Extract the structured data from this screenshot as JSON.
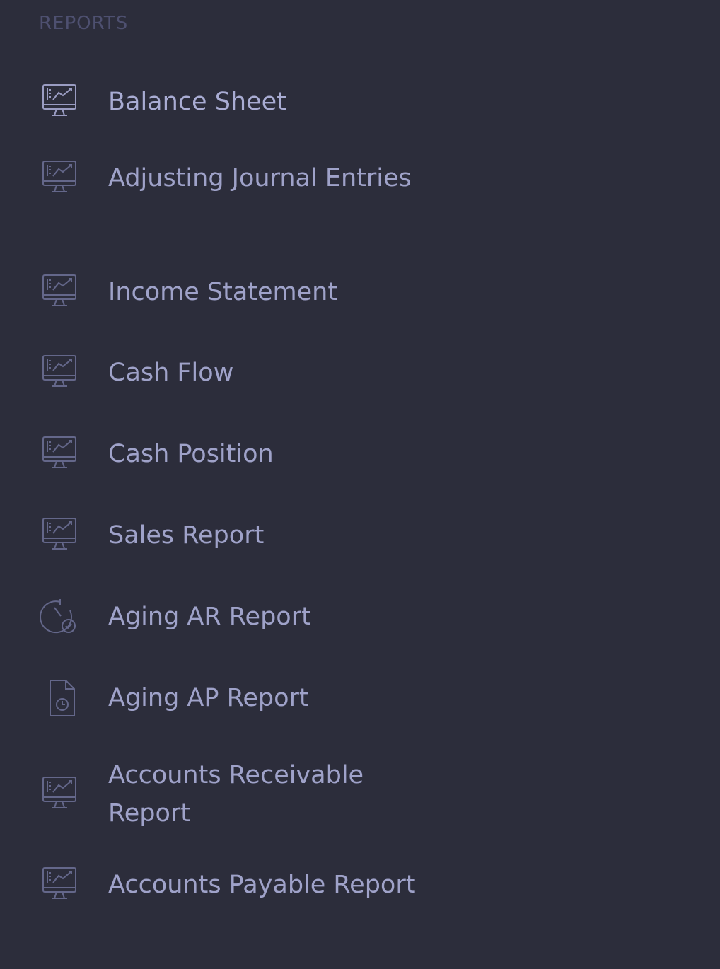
{
  "sidebar": {
    "section_title": "REPORTS",
    "items": [
      {
        "label": "Balance Sheet",
        "icon": "monitor-chart-icon",
        "active": true
      },
      {
        "label": "Adjusting Journal Entries",
        "icon": "monitor-chart-icon"
      },
      {
        "label": "Income Statement",
        "icon": "monitor-chart-icon"
      },
      {
        "label": "Cash Flow",
        "icon": "monitor-chart-icon"
      },
      {
        "label": "Cash Position",
        "icon": "monitor-chart-icon"
      },
      {
        "label": "Sales Report",
        "icon": "monitor-chart-icon"
      },
      {
        "label": "Aging AR Report",
        "icon": "clock-check-icon"
      },
      {
        "label": "Aging AP Report",
        "icon": "document-clock-icon"
      },
      {
        "label": "Accounts Receivable Report",
        "icon": "monitor-chart-icon"
      },
      {
        "label": "Accounts Payable Report",
        "icon": "monitor-chart-icon"
      }
    ]
  },
  "colors": {
    "background": "#2c2d3b",
    "text": "#9fa2c9",
    "muted": "#4e5070",
    "icon": "#64678a"
  }
}
